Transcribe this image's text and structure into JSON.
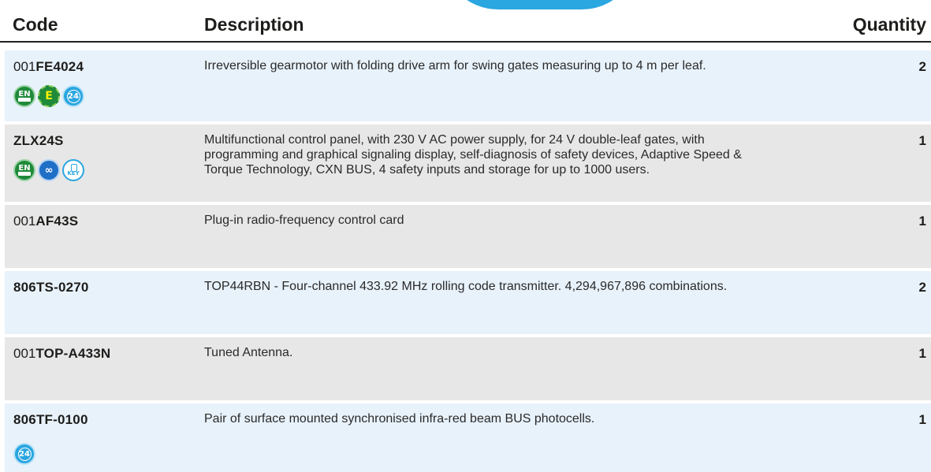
{
  "header": {
    "code": "Code",
    "description": "Description",
    "quantity": "Quantity"
  },
  "rows": [
    {
      "code_prefix": "001",
      "code": "FE4024",
      "description": "Irreversible gearmotor with folding drive arm for swing gates measuring up to 4 m per leaf.",
      "quantity": "2",
      "bg": "#e8f2fb",
      "icons": [
        {
          "name": "en-tested-icon",
          "label": "EN",
          "sub": "TESTED"
        },
        {
          "name": "energy-saving-icon",
          "label": "E"
        },
        {
          "name": "24v-icon",
          "label": "24"
        }
      ]
    },
    {
      "code_prefix": "",
      "code": "ZLX24S",
      "description": "Multifunctional control panel, with 230 V AC power supply, for 24 V double-leaf gates, with programming and graphical signaling display, self-diagnosis of safety devices, Adaptive Speed & Torque Technology, CXN BUS, 4 safety inputs and storage for up to 1000 users.",
      "quantity": "1",
      "bg": "#e7e7e7",
      "icons": [
        {
          "name": "en-tested-icon",
          "label": "EN",
          "sub": "TESTED"
        },
        {
          "name": "cxn-bus-icon",
          "label": "∞"
        },
        {
          "name": "key-icon",
          "label": "KEY"
        }
      ]
    },
    {
      "code_prefix": "001",
      "code": "AF43S",
      "description": "Plug-in radio-frequency control card",
      "quantity": "1",
      "bg": "#e7e7e7",
      "icons": []
    },
    {
      "code_prefix": "",
      "code": "806TS-0270",
      "description": "TOP44RBN - Four-channel 433.92 MHz rolling code transmitter. 4,294,967,896 combinations.",
      "quantity": "2",
      "bg": "#e8f2fb",
      "icons": []
    },
    {
      "code_prefix": "001",
      "code": "TOP-A433N",
      "description": "Tuned Antenna.",
      "quantity": "1",
      "bg": "#e7e7e7",
      "icons": []
    },
    {
      "code_prefix": "",
      "code": "806TF-0100",
      "description": "Pair of surface mounted synchronised infra-red beam BUS photocells.",
      "quantity": "1",
      "bg": "#e8f2fb",
      "icons": [
        {
          "name": "24v-icon",
          "label": "24"
        }
      ]
    }
  ]
}
